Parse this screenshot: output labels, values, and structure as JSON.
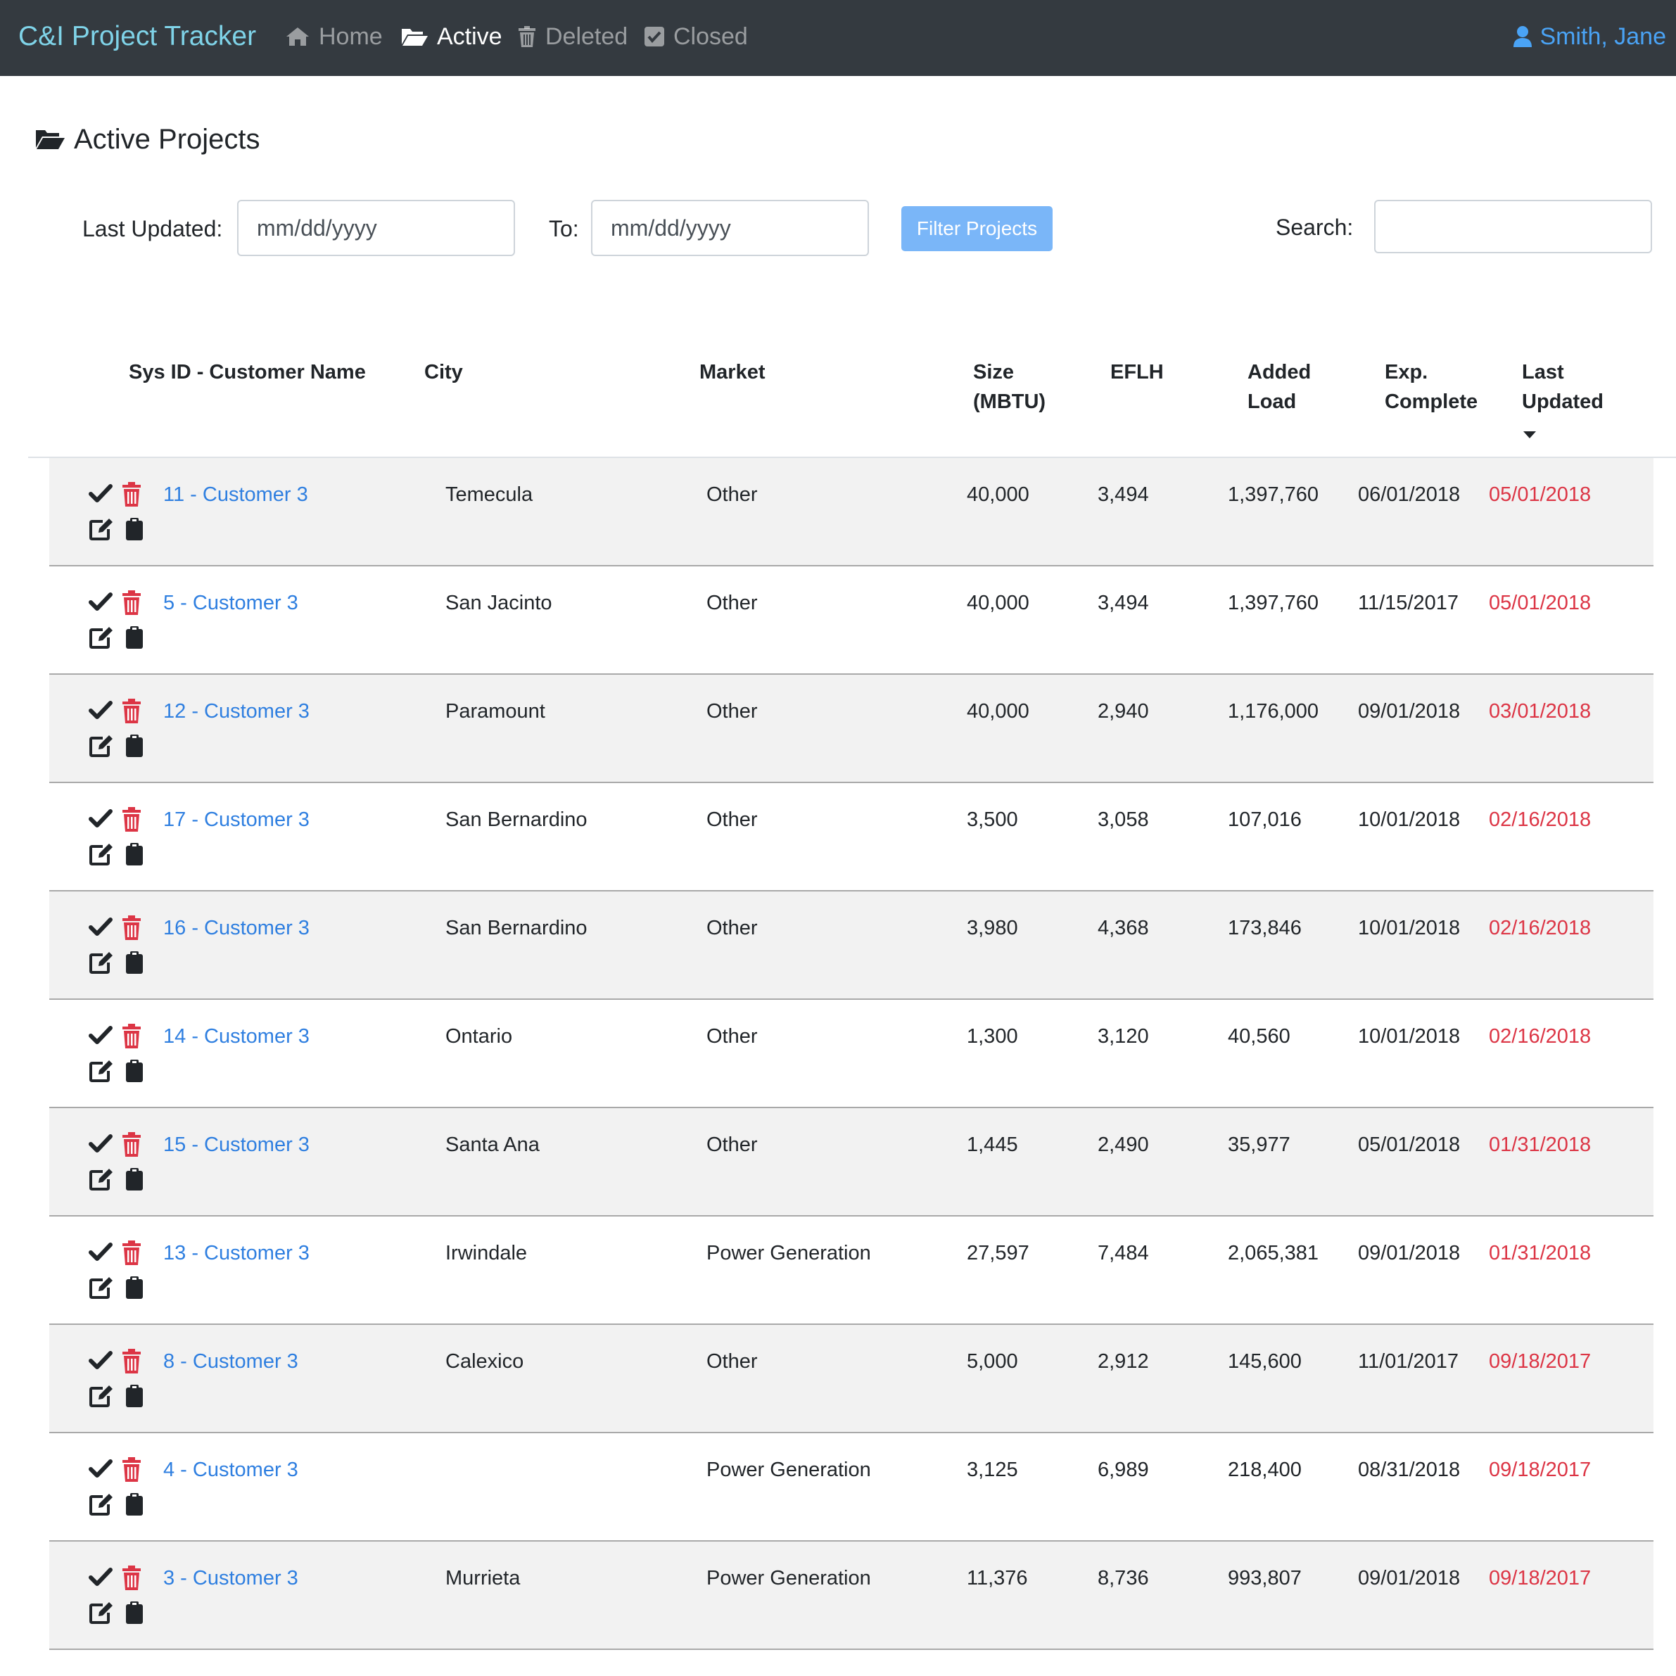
{
  "navbar": {
    "brand": "C&I Project Tracker",
    "items": [
      {
        "label": "Home",
        "icon": "home-icon",
        "active": false
      },
      {
        "label": "Active",
        "icon": "folder-open-icon",
        "active": true
      },
      {
        "label": "Deleted",
        "icon": "trash-icon",
        "active": false
      },
      {
        "label": "Closed",
        "icon": "check-square-icon",
        "active": false
      }
    ],
    "user": "Smith, Jane"
  },
  "page": {
    "title": "Active Projects"
  },
  "filters": {
    "last_updated_label": "Last Updated:",
    "from_placeholder": "mm/dd/yyyy",
    "to_label": "To:",
    "to_placeholder": "mm/dd/yyyy",
    "filter_button": "Filter Projects",
    "search_label": "Search:"
  },
  "table": {
    "headers": {
      "name": [
        "Sys ID - Customer Name"
      ],
      "city": [
        "City"
      ],
      "market": [
        "Market"
      ],
      "size": [
        "Size",
        "(MBTU)"
      ],
      "eflh": [
        "EFLH"
      ],
      "load": [
        "Added",
        "Load"
      ],
      "exp": [
        "Exp.",
        "Complete"
      ],
      "upd": [
        "Last",
        "Updated"
      ]
    },
    "sort_column": "Last Updated",
    "rows": [
      {
        "name": "11 - Customer 3",
        "city": "Temecula",
        "market": "Other",
        "size": "40,000",
        "eflh": "3,494",
        "load": "1,397,760",
        "exp": "06/01/2018",
        "upd": "05/01/2018"
      },
      {
        "name": "5 - Customer 3",
        "city": "San Jacinto",
        "market": "Other",
        "size": "40,000",
        "eflh": "3,494",
        "load": "1,397,760",
        "exp": "11/15/2017",
        "upd": "05/01/2018"
      },
      {
        "name": "12 - Customer 3",
        "city": "Paramount",
        "market": "Other",
        "size": "40,000",
        "eflh": "2,940",
        "load": "1,176,000",
        "exp": "09/01/2018",
        "upd": "03/01/2018"
      },
      {
        "name": "17 - Customer 3",
        "city": "San Bernardino",
        "market": "Other",
        "size": "3,500",
        "eflh": "3,058",
        "load": "107,016",
        "exp": "10/01/2018",
        "upd": "02/16/2018"
      },
      {
        "name": "16 - Customer 3",
        "city": "San Bernardino",
        "market": "Other",
        "size": "3,980",
        "eflh": "4,368",
        "load": "173,846",
        "exp": "10/01/2018",
        "upd": "02/16/2018"
      },
      {
        "name": "14 - Customer 3",
        "city": "Ontario",
        "market": "Other",
        "size": "1,300",
        "eflh": "3,120",
        "load": "40,560",
        "exp": "10/01/2018",
        "upd": "02/16/2018"
      },
      {
        "name": "15 - Customer 3",
        "city": "Santa Ana",
        "market": "Other",
        "size": "1,445",
        "eflh": "2,490",
        "load": "35,977",
        "exp": "05/01/2018",
        "upd": "01/31/2018"
      },
      {
        "name": "13 - Customer 3",
        "city": "Irwindale",
        "market": "Power Generation",
        "size": "27,597",
        "eflh": "7,484",
        "load": "2,065,381",
        "exp": "09/01/2018",
        "upd": "01/31/2018"
      },
      {
        "name": "8 - Customer 3",
        "city": "Calexico",
        "market": "Other",
        "size": "5,000",
        "eflh": "2,912",
        "load": "145,600",
        "exp": "11/01/2017",
        "upd": "09/18/2017"
      },
      {
        "name": "4 - Customer 3",
        "city": "",
        "market": "Power Generation",
        "size": "3,125",
        "eflh": "6,989",
        "load": "218,400",
        "exp": "08/31/2018",
        "upd": "09/18/2017"
      },
      {
        "name": "3 - Customer 3",
        "city": "Murrieta",
        "market": "Power Generation",
        "size": "11,376",
        "eflh": "8,736",
        "load": "993,807",
        "exp": "09/01/2018",
        "upd": "09/18/2017"
      }
    ]
  },
  "colors": {
    "navbar_bg": "#343a40",
    "brand": "#7fd3e8",
    "link": "#2f7fe0",
    "user": "#4aa3f5",
    "date_red": "#dc3545",
    "trash_red": "#dc3545",
    "button": "#7ab6f8",
    "stripe": "#f2f2f2"
  }
}
